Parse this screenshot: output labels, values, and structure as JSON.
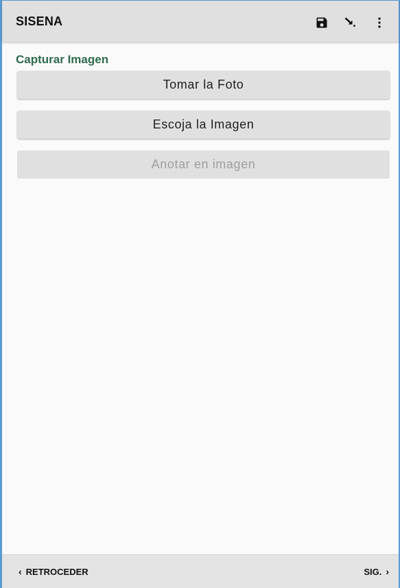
{
  "app_bar": {
    "title": "SISENA",
    "actions": [
      {
        "icon": "save-icon"
      },
      {
        "icon": "go-to-icon"
      },
      {
        "icon": "more-vert-icon"
      }
    ]
  },
  "section": {
    "title": "Capturar Imagen",
    "title_color": "#2e6b4d"
  },
  "buttons": {
    "take_photo": "Tomar la Foto",
    "choose_image": "Escoja la Imagen",
    "annotate": "Anotar en imagen",
    "annotate_enabled": false
  },
  "bottom_nav": {
    "prev_label": "RETROCEDER",
    "next_label": "SIG.",
    "prev_chevron": "‹",
    "next_chevron": "›"
  }
}
